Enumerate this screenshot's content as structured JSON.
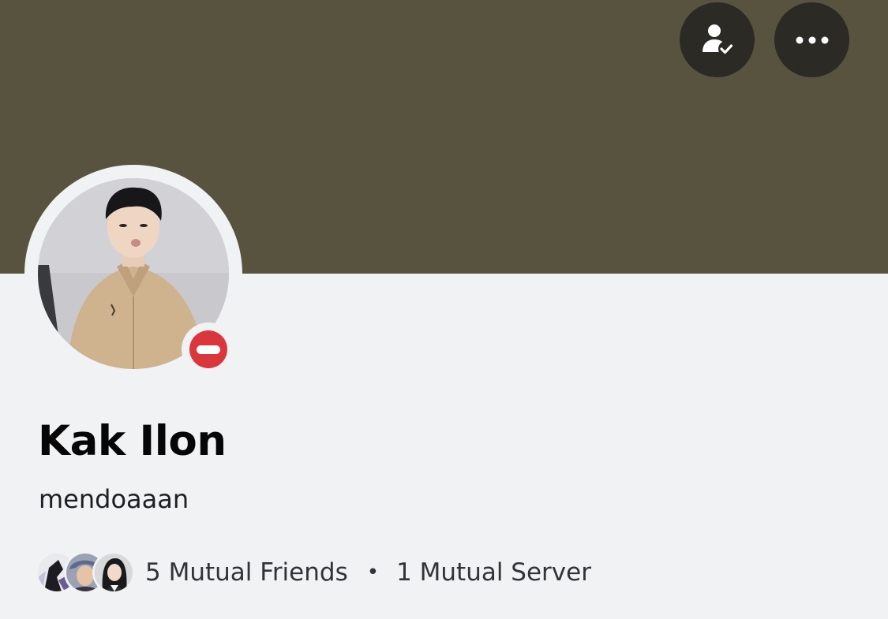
{
  "profile": {
    "display_name": "Kak Ilon",
    "username": "mendoaaan",
    "status": "do-not-disturb",
    "banner_color": "#58533f",
    "status_color": "#da373c"
  },
  "header_actions": [
    {
      "icon": "friend-check-icon"
    },
    {
      "icon": "more-dots-icon"
    }
  ],
  "mutuals": {
    "friends_label": "5 Mutual Friends",
    "separator": "•",
    "servers_label": "1 Mutual Server"
  }
}
